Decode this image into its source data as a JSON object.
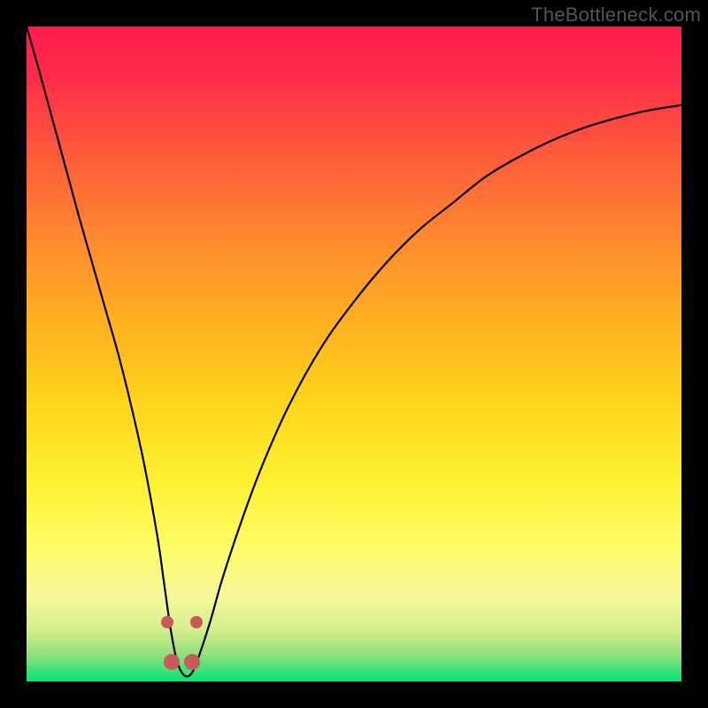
{
  "watermark": {
    "text": "TheBottleneck.com"
  },
  "chart_data": {
    "type": "line",
    "title": "",
    "xlabel": "",
    "ylabel": "",
    "xlim": [
      0,
      100
    ],
    "ylim": [
      0,
      100
    ],
    "grid": false,
    "legend": false,
    "series": [
      {
        "name": "bottleneck-curve",
        "x": [
          0,
          2,
          5,
          8,
          10,
          12,
          14,
          16,
          18,
          20,
          21,
          22,
          23,
          24,
          25,
          26,
          28,
          30,
          33,
          36,
          40,
          45,
          50,
          55,
          60,
          65,
          70,
          75,
          80,
          85,
          90,
          95,
          100
        ],
        "values": [
          100,
          93,
          82,
          71,
          64,
          57,
          50,
          42,
          33,
          22,
          15,
          8,
          3,
          1,
          1,
          3,
          9,
          16,
          25,
          33,
          42,
          51,
          58,
          64,
          69,
          73,
          77,
          80,
          82.5,
          84.5,
          86,
          87.2,
          88
        ]
      }
    ],
    "markers": [
      {
        "name": "nodule-left-upper",
        "x": 21.5,
        "y": 9
      },
      {
        "name": "nodule-left-lower",
        "x": 22.2,
        "y": 3
      },
      {
        "name": "nodule-right-lower",
        "x": 25.3,
        "y": 3
      },
      {
        "name": "nodule-right-upper",
        "x": 26.0,
        "y": 9
      }
    ],
    "gradient_stops": [
      {
        "pos": 0,
        "color": "#ff1a4d"
      },
      {
        "pos": 33,
        "color": "#ff8c2e"
      },
      {
        "pos": 70,
        "color": "#fff233"
      },
      {
        "pos": 100,
        "color": "#00e676"
      }
    ]
  }
}
